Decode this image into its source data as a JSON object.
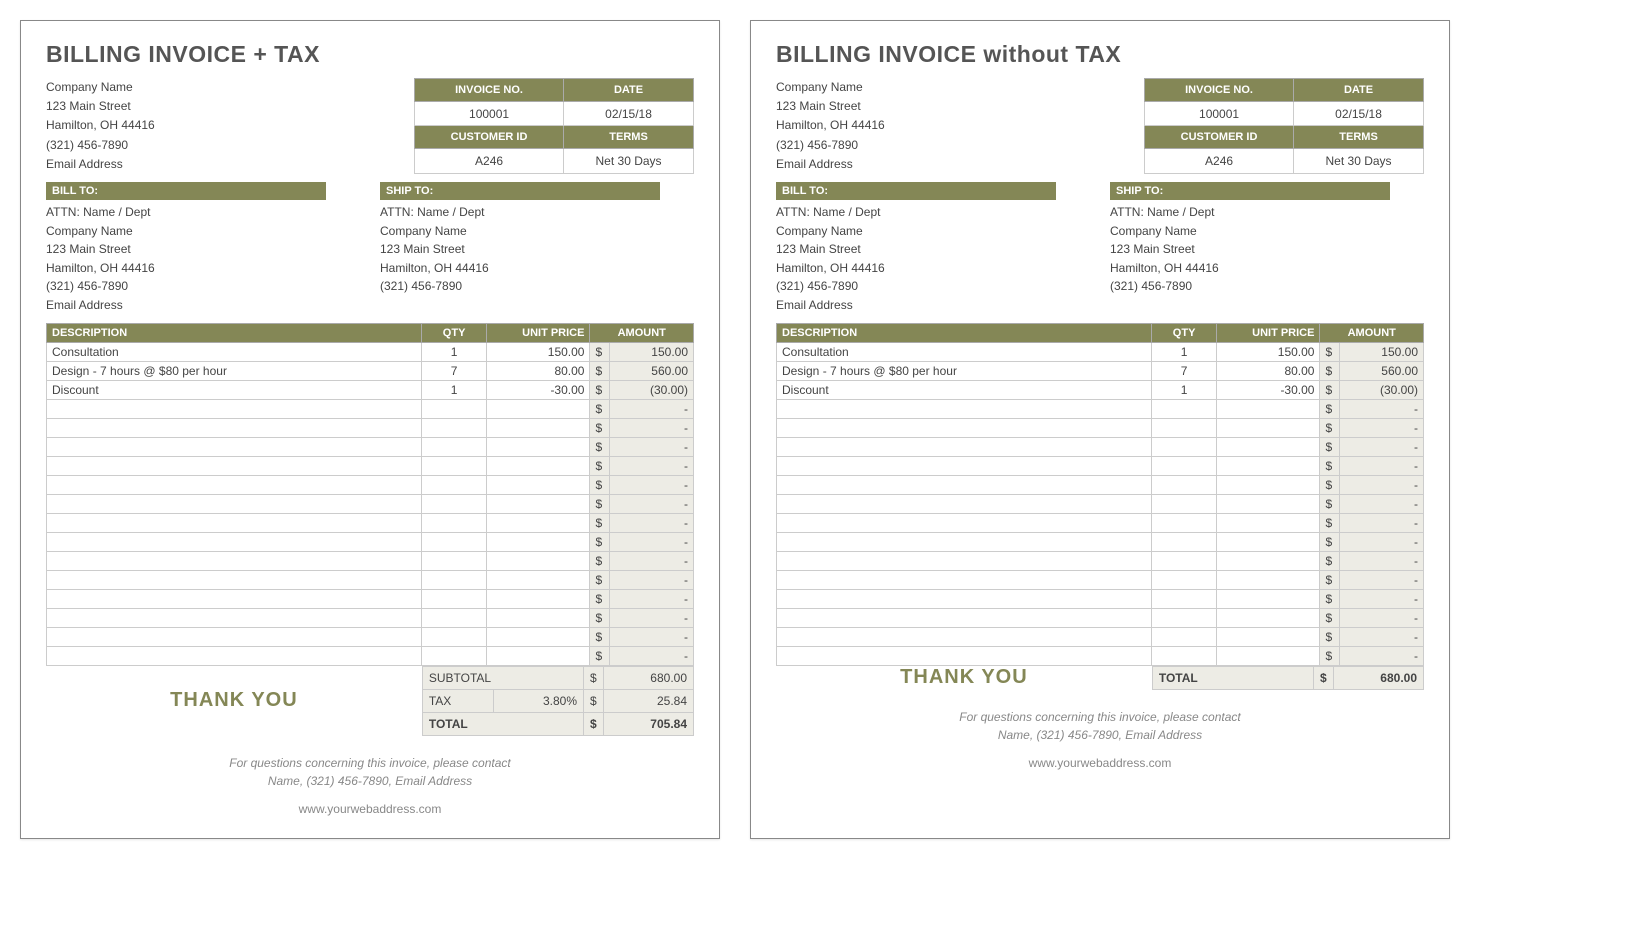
{
  "left": {
    "title": "BILLING INVOICE + TAX",
    "company": [
      "Company Name",
      "123 Main Street",
      "Hamilton, OH  44416",
      "(321) 456-7890",
      "Email Address"
    ],
    "meta": {
      "h1": "INVOICE NO.",
      "h2": "DATE",
      "v1": "100001",
      "v2": "02/15/18",
      "h3": "CUSTOMER ID",
      "h4": "TERMS",
      "v3": "A246",
      "v4": "Net 30 Days"
    },
    "billto_label": "BILL TO:",
    "shipto_label": "SHIP TO:",
    "billto": [
      "ATTN: Name / Dept",
      "Company Name",
      "123 Main Street",
      "Hamilton, OH  44416",
      "(321) 456-7890",
      "Email Address"
    ],
    "shipto": [
      "ATTN: Name / Dept",
      "Company Name",
      "123 Main Street",
      "Hamilton, OH  44416",
      "(321) 456-7890"
    ],
    "cols": {
      "desc": "DESCRIPTION",
      "qty": "QTY",
      "price": "UNIT PRICE",
      "amount": "AMOUNT"
    },
    "rows": [
      {
        "desc": "Consultation",
        "qty": "1",
        "price": "150.00",
        "sym": "$",
        "amt": "150.00"
      },
      {
        "desc": "Design - 7 hours @ $80 per hour",
        "qty": "7",
        "price": "80.00",
        "sym": "$",
        "amt": "560.00"
      },
      {
        "desc": "Discount",
        "qty": "1",
        "price": "-30.00",
        "sym": "$",
        "amt": "(30.00)"
      },
      {
        "desc": "",
        "qty": "",
        "price": "",
        "sym": "$",
        "amt": "-"
      },
      {
        "desc": "",
        "qty": "",
        "price": "",
        "sym": "$",
        "amt": "-"
      },
      {
        "desc": "",
        "qty": "",
        "price": "",
        "sym": "$",
        "amt": "-"
      },
      {
        "desc": "",
        "qty": "",
        "price": "",
        "sym": "$",
        "amt": "-"
      },
      {
        "desc": "",
        "qty": "",
        "price": "",
        "sym": "$",
        "amt": "-"
      },
      {
        "desc": "",
        "qty": "",
        "price": "",
        "sym": "$",
        "amt": "-"
      },
      {
        "desc": "",
        "qty": "",
        "price": "",
        "sym": "$",
        "amt": "-"
      },
      {
        "desc": "",
        "qty": "",
        "price": "",
        "sym": "$",
        "amt": "-"
      },
      {
        "desc": "",
        "qty": "",
        "price": "",
        "sym": "$",
        "amt": "-"
      },
      {
        "desc": "",
        "qty": "",
        "price": "",
        "sym": "$",
        "amt": "-"
      },
      {
        "desc": "",
        "qty": "",
        "price": "",
        "sym": "$",
        "amt": "-"
      },
      {
        "desc": "",
        "qty": "",
        "price": "",
        "sym": "$",
        "amt": "-"
      },
      {
        "desc": "",
        "qty": "",
        "price": "",
        "sym": "$",
        "amt": "-"
      },
      {
        "desc": "",
        "qty": "",
        "price": "",
        "sym": "$",
        "amt": "-"
      }
    ],
    "thankyou": "THANK YOU",
    "totals": {
      "subtotal_label": "SUBTOTAL",
      "subtotal_sym": "$",
      "subtotal": "680.00",
      "tax_label": "TAX",
      "tax_rate": "3.80%",
      "tax_sym": "$",
      "tax": "25.84",
      "total_label": "TOTAL",
      "total_sym": "$",
      "total": "705.84"
    },
    "footer1": "For questions concerning this invoice, please contact",
    "footer2": "Name, (321) 456-7890, Email Address",
    "footer3": "www.yourwebaddress.com"
  },
  "right": {
    "title": "BILLING INVOICE without TAX",
    "company": [
      "Company Name",
      "123 Main Street",
      "Hamilton, OH  44416",
      "(321) 456-7890",
      "Email Address"
    ],
    "meta": {
      "h1": "INVOICE NO.",
      "h2": "DATE",
      "v1": "100001",
      "v2": "02/15/18",
      "h3": "CUSTOMER ID",
      "h4": "TERMS",
      "v3": "A246",
      "v4": "Net 30 Days"
    },
    "billto_label": "BILL TO:",
    "shipto_label": "SHIP TO:",
    "billto": [
      "ATTN: Name / Dept",
      "Company Name",
      "123 Main Street",
      "Hamilton, OH  44416",
      "(321) 456-7890",
      "Email Address"
    ],
    "shipto": [
      "ATTN: Name / Dept",
      "Company Name",
      "123 Main Street",
      "Hamilton, OH  44416",
      "(321) 456-7890"
    ],
    "cols": {
      "desc": "DESCRIPTION",
      "qty": "QTY",
      "price": "UNIT PRICE",
      "amount": "AMOUNT"
    },
    "rows": [
      {
        "desc": "Consultation",
        "qty": "1",
        "price": "150.00",
        "sym": "$",
        "amt": "150.00"
      },
      {
        "desc": "Design - 7 hours @ $80 per hour",
        "qty": "7",
        "price": "80.00",
        "sym": "$",
        "amt": "560.00"
      },
      {
        "desc": "Discount",
        "qty": "1",
        "price": "-30.00",
        "sym": "$",
        "amt": "(30.00)"
      },
      {
        "desc": "",
        "qty": "",
        "price": "",
        "sym": "$",
        "amt": "-"
      },
      {
        "desc": "",
        "qty": "",
        "price": "",
        "sym": "$",
        "amt": "-"
      },
      {
        "desc": "",
        "qty": "",
        "price": "",
        "sym": "$",
        "amt": "-"
      },
      {
        "desc": "",
        "qty": "",
        "price": "",
        "sym": "$",
        "amt": "-"
      },
      {
        "desc": "",
        "qty": "",
        "price": "",
        "sym": "$",
        "amt": "-"
      },
      {
        "desc": "",
        "qty": "",
        "price": "",
        "sym": "$",
        "amt": "-"
      },
      {
        "desc": "",
        "qty": "",
        "price": "",
        "sym": "$",
        "amt": "-"
      },
      {
        "desc": "",
        "qty": "",
        "price": "",
        "sym": "$",
        "amt": "-"
      },
      {
        "desc": "",
        "qty": "",
        "price": "",
        "sym": "$",
        "amt": "-"
      },
      {
        "desc": "",
        "qty": "",
        "price": "",
        "sym": "$",
        "amt": "-"
      },
      {
        "desc": "",
        "qty": "",
        "price": "",
        "sym": "$",
        "amt": "-"
      },
      {
        "desc": "",
        "qty": "",
        "price": "",
        "sym": "$",
        "amt": "-"
      },
      {
        "desc": "",
        "qty": "",
        "price": "",
        "sym": "$",
        "amt": "-"
      },
      {
        "desc": "",
        "qty": "",
        "price": "",
        "sym": "$",
        "amt": "-"
      }
    ],
    "thankyou": "THANK YOU",
    "totals": {
      "total_label": "TOTAL",
      "total_sym": "$",
      "total": "680.00"
    },
    "footer1": "For questions concerning this invoice, please contact",
    "footer2": "Name, (321) 456-7890, Email Address",
    "footer3": "www.yourwebaddress.com"
  }
}
